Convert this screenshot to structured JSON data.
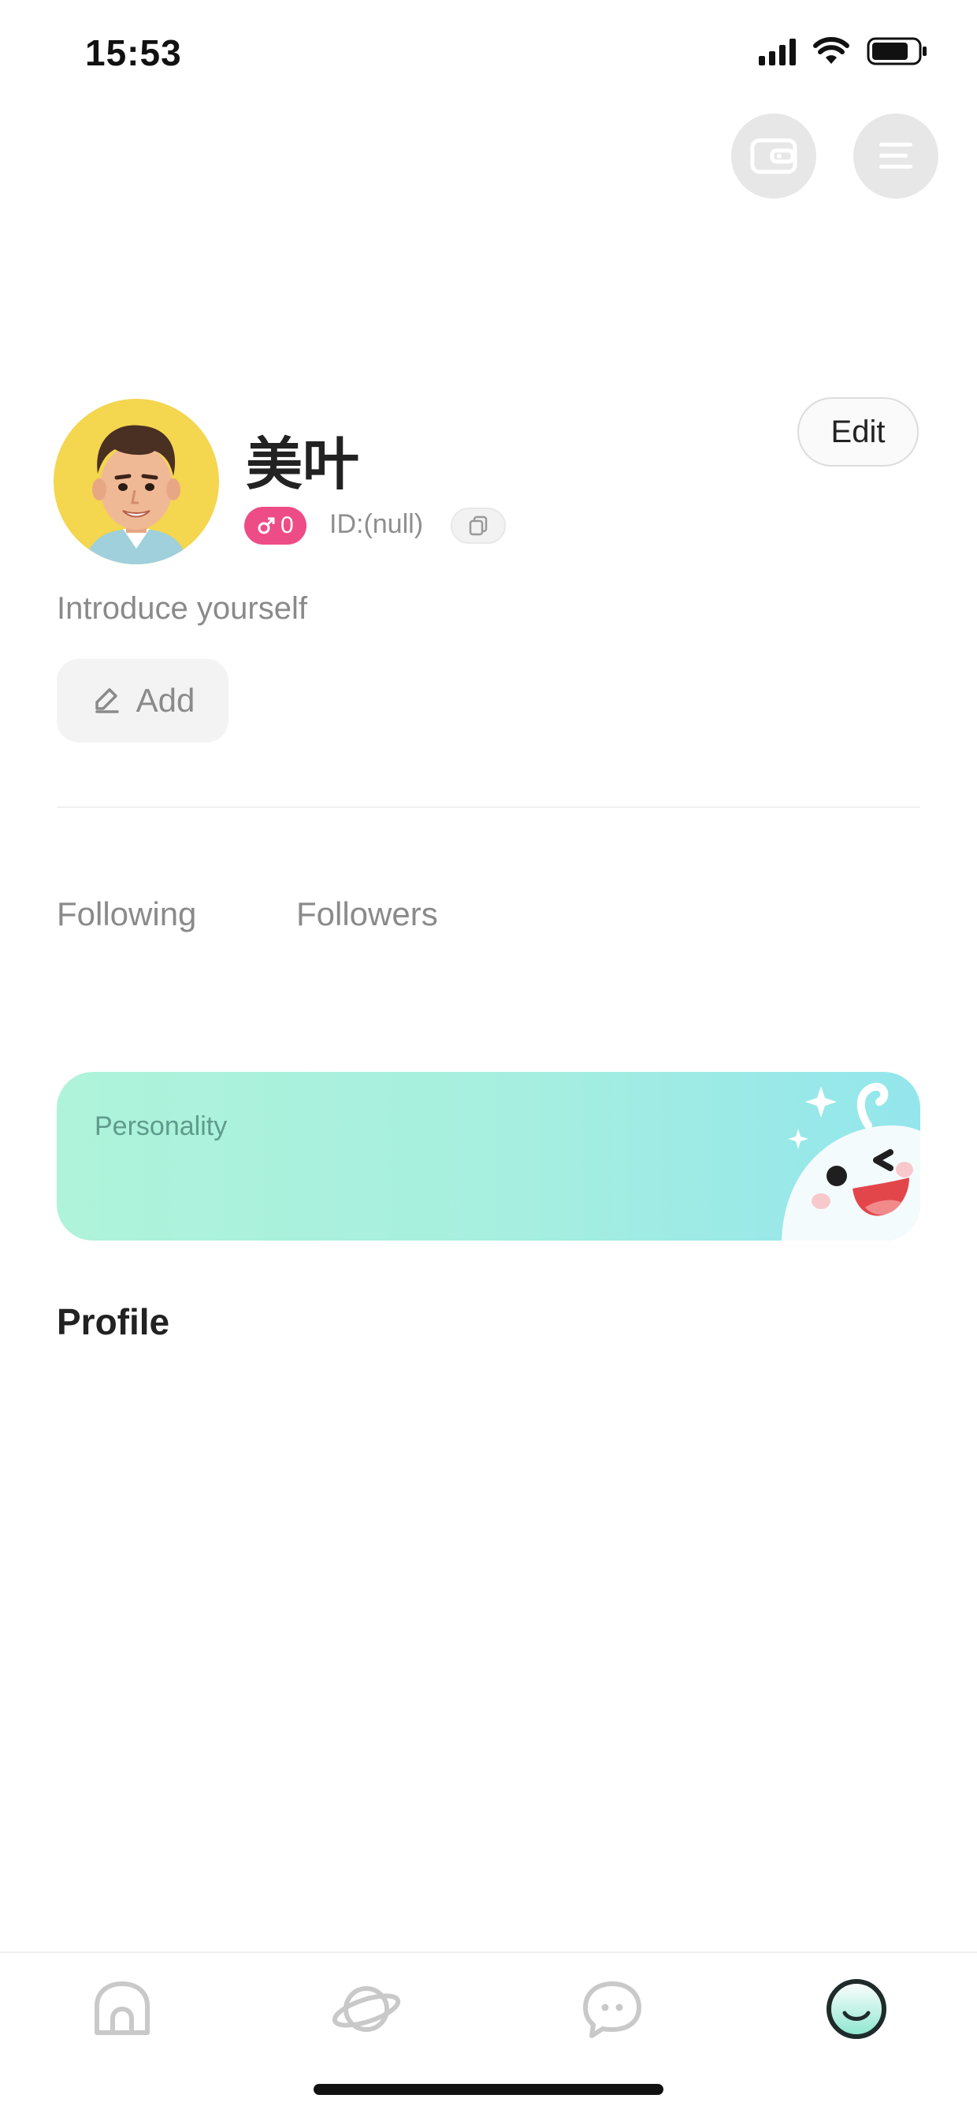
{
  "status_bar": {
    "time": "15:53",
    "battery_level": 0.8
  },
  "profile": {
    "name": "美叶",
    "gender_count": "0",
    "id_text": "ID:(null)",
    "edit_label": "Edit",
    "intro_placeholder": "Introduce yourself",
    "add_label": "Add"
  },
  "stats": {
    "following_label": "Following",
    "followers_label": "Followers"
  },
  "personality": {
    "label": "Personality"
  },
  "sections": {
    "profile_heading": "Profile"
  },
  "tabs": [
    {
      "icon": "home-icon",
      "active": false
    },
    {
      "icon": "planet-icon",
      "active": false
    },
    {
      "icon": "chat-icon",
      "active": false
    },
    {
      "icon": "me-icon",
      "active": true
    }
  ],
  "colors": {
    "accent_pink": "#ee4c86",
    "mint": "#aef3da",
    "avatar_bg": "#f4d64f"
  }
}
